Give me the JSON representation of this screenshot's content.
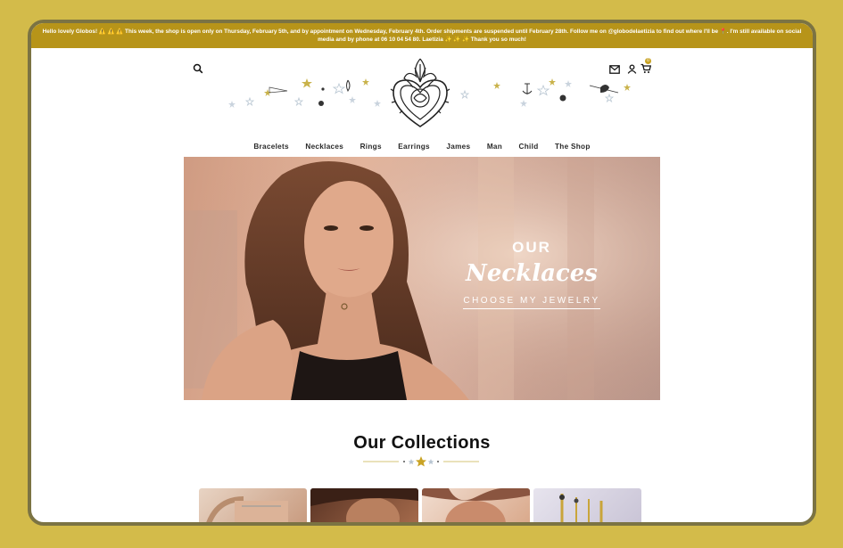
{
  "announcement": "Hello lovely Globos! ⚠️ ⚠️ ⚠️ This week, the shop is open only on Thursday, February 5th, and by appointment on Wednesday, February 4th. Order shipments are suspended until February 28th. Follow me on @globodelaetizia to find out where I'll be 📍. I'm still available on social media and by phone at 06 10 04 54 80. Laetizia ✨ ✨ ✨ Thank you so much!",
  "header": {
    "cart_count": "0"
  },
  "nav": {
    "items": [
      "Bracelets",
      "Necklaces",
      "Rings",
      "Earrings",
      "James",
      "Man",
      "Child",
      "The Shop"
    ]
  },
  "hero": {
    "kicker": "OUR",
    "title": "Necklaces",
    "cta": "CHOOSE MY JEWELRY"
  },
  "collections": {
    "title": "Our Collections"
  },
  "colors": {
    "background": "#d3bb4a",
    "announcement_bar": "#b79419",
    "accent_gold": "#c8a325"
  },
  "icons": [
    "search-icon",
    "mail-icon",
    "user-icon",
    "cart-icon"
  ]
}
